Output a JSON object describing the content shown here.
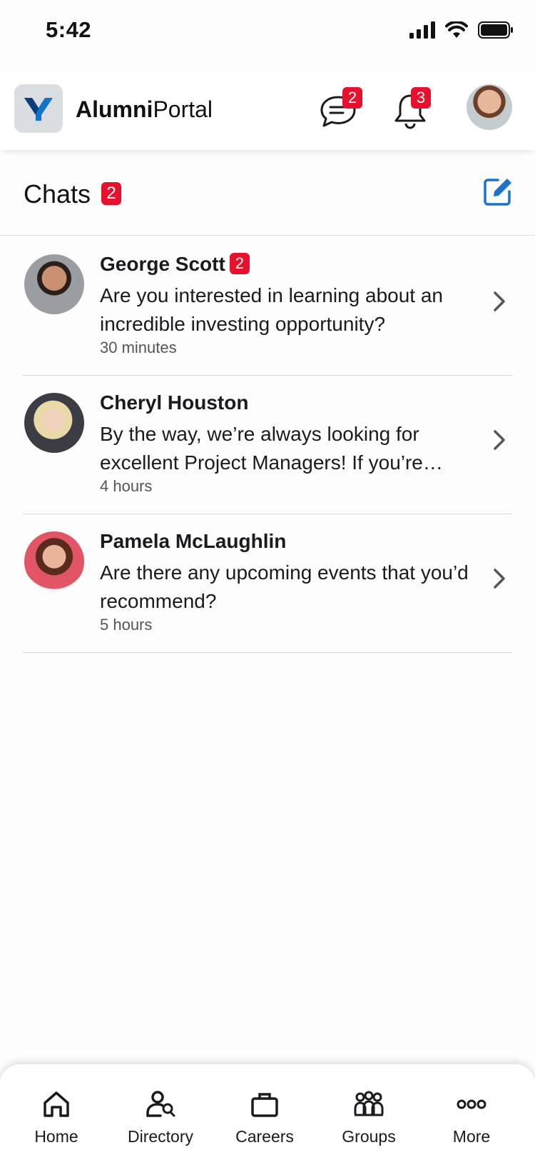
{
  "status_bar": {
    "time": "5:42"
  },
  "header": {
    "app_name_bold": "Alumni",
    "app_name_regular": "Portal",
    "messages_badge": "2",
    "notifications_badge": "3"
  },
  "chats": {
    "title": "Chats",
    "unread_count": "2",
    "items": [
      {
        "name": "George Scott",
        "badge": "2",
        "message": "Are you interested in learning about an incredible investing opportunity?",
        "time": "30 minutes"
      },
      {
        "name": "Cheryl Houston",
        "message": "By the way, we’re always looking for excellent Project Managers! If you’re…",
        "time": "4 hours"
      },
      {
        "name": "Pamela McLaughlin",
        "message": "Are there any upcoming events that you’d recommend?",
        "time": "5 hours"
      }
    ]
  },
  "bottom_nav": [
    {
      "label": "Home",
      "icon": "home-icon"
    },
    {
      "label": "Directory",
      "icon": "directory-icon"
    },
    {
      "label": "Careers",
      "icon": "briefcase-icon"
    },
    {
      "label": "Groups",
      "icon": "groups-icon"
    },
    {
      "label": "More",
      "icon": "more-icon"
    }
  ],
  "colors": {
    "badge": "#e8112d",
    "accent": "#1a73c9",
    "logo_bg": "#d9dde2"
  }
}
